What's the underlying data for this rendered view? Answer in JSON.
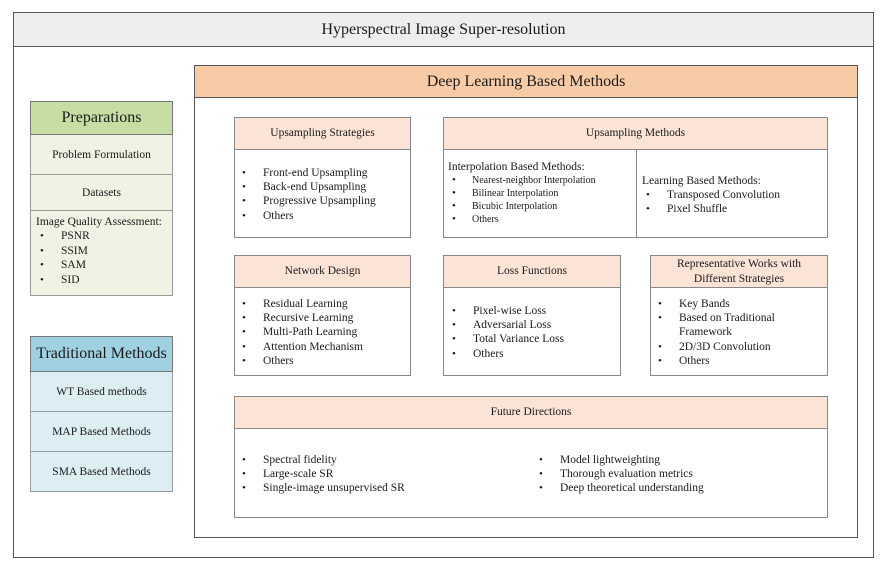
{
  "title": "Hyperspectral Image Super-resolution",
  "preparations": {
    "header": "Preparations",
    "items": [
      "Problem Formulation",
      "Datasets"
    ],
    "quality": {
      "title": "Image Quality Assessment:",
      "metrics": [
        "PSNR",
        "SSIM",
        "SAM",
        "SID"
      ]
    },
    "colors": {
      "header": "#c6dda3",
      "body": "#eef3e4"
    }
  },
  "traditional": {
    "header": "Traditional Methods",
    "items": [
      "WT Based methods",
      "MAP Based Methods",
      "SMA Based Methods"
    ],
    "colors": {
      "header": "#9fd1e3",
      "body": "#dcedf4"
    }
  },
  "deep_learning": {
    "header": "Deep Learning Based Methods",
    "colors": {
      "header": "#f8cba7",
      "card_header": "#fbe4d5"
    },
    "upsampling_strategies": {
      "header": "Upsampling Strategies",
      "items": [
        "Front-end Upsampling",
        "Back-end Upsampling",
        "Progressive Upsampling",
        "Others"
      ]
    },
    "upsampling_methods": {
      "header": "Upsampling Methods",
      "interpolation": {
        "title": "Interpolation Based Methods:",
        "items": [
          "Nearest-neighbor Interpolation",
          "Bilinear Interpolation",
          "Bicubic Interpolation",
          "Others"
        ]
      },
      "learning": {
        "title": "Learning Based Methods:",
        "items": [
          "Transposed Convolution",
          "Pixel Shuffle"
        ]
      }
    },
    "network_design": {
      "header": "Network Design",
      "items": [
        "Residual Learning",
        "Recursive Learning",
        "Multi-Path Learning",
        "Attention Mechanism",
        "Others"
      ]
    },
    "loss_functions": {
      "header": "Loss Functions",
      "items": [
        "Pixel-wise Loss",
        "Adversarial Loss",
        "Total Variance Loss",
        "Others"
      ]
    },
    "representative_works": {
      "header_line1": "Representative Works with",
      "header_line2": "Different Strategies",
      "items": [
        "Key Bands",
        "Based on Traditional",
        "2D/3D Convolution",
        "Others"
      ],
      "continuation": "Framework"
    },
    "future_directions": {
      "header": "Future Directions",
      "left": [
        "Spectral fidelity",
        "Large-scale SR",
        "Single-image unsupervised SR"
      ],
      "right": [
        "Model lightweighting",
        "Thorough evaluation metrics",
        "Deep theoretical understanding"
      ]
    }
  }
}
